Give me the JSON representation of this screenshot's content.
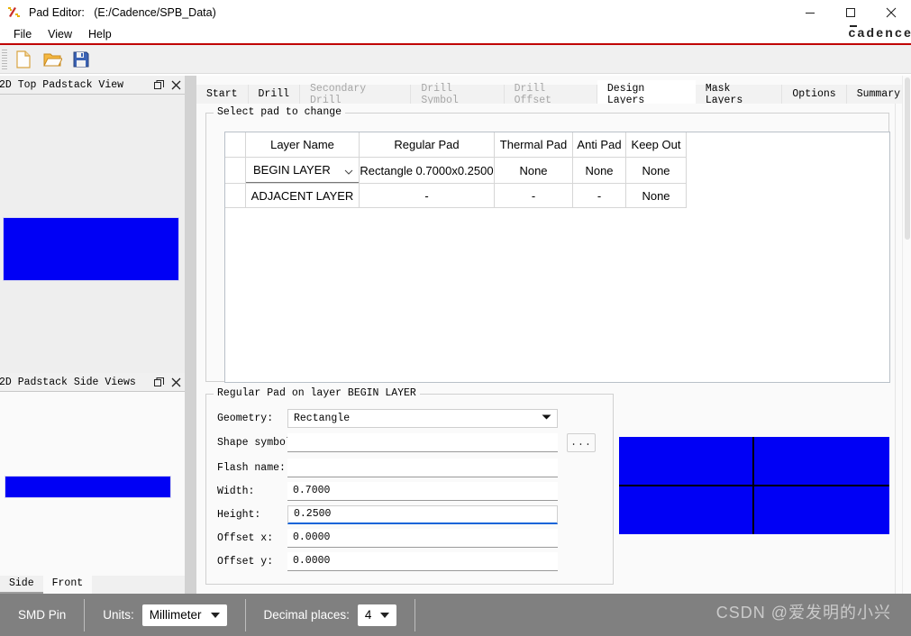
{
  "window": {
    "title": "Pad Editor:   (E:/Cadence/SPB_Data)",
    "icon": "pad-editor-icon",
    "minimize": "minimize-icon",
    "maximize": "maximize-icon",
    "close": "close-icon",
    "brand": "cadence"
  },
  "menubar": {
    "items": [
      {
        "label": "File"
      },
      {
        "label": "View"
      },
      {
        "label": "Help"
      }
    ]
  },
  "toolbar": {
    "buttons": [
      {
        "name": "new-icon",
        "tooltip": "New"
      },
      {
        "name": "open-icon",
        "tooltip": "Open"
      },
      {
        "name": "save-icon",
        "tooltip": "Save"
      }
    ]
  },
  "left_panels": [
    {
      "title": "2D Top Padstack View",
      "float_icon": "restore-icon",
      "close_icon": "close-icon"
    },
    {
      "title": "2D Padstack Side Views",
      "float_icon": "restore-icon",
      "close_icon": "close-icon"
    }
  ],
  "side_tabs": [
    {
      "label": "Side",
      "active": true
    },
    {
      "label": "Front",
      "active": false
    }
  ],
  "tabs": [
    {
      "label": "Start",
      "state": "normal"
    },
    {
      "label": "Drill",
      "state": "normal"
    },
    {
      "label": "Secondary Drill",
      "state": "disabled"
    },
    {
      "label": "Drill Symbol",
      "state": "disabled"
    },
    {
      "label": "Drill Offset",
      "state": "disabled"
    },
    {
      "label": "Design Layers",
      "state": "active"
    },
    {
      "label": "Mask Layers",
      "state": "normal"
    },
    {
      "label": "Options",
      "state": "normal"
    },
    {
      "label": "Summary",
      "state": "normal"
    }
  ],
  "select_pad_group": {
    "title": "Select pad to change"
  },
  "pad_table": {
    "headers": [
      "",
      "Layer Name",
      "Regular Pad",
      "Thermal Pad",
      "Anti Pad",
      "Keep Out"
    ],
    "rows": [
      {
        "layer": "BEGIN LAYER",
        "layer_is_select": true,
        "regular": "Rectangle 0.7000x0.2500",
        "thermal": "None",
        "anti": "None",
        "keepout": "None",
        "dim": false
      },
      {
        "layer": "ADJACENT LAYER",
        "layer_is_select": false,
        "regular": "-",
        "thermal": "-",
        "anti": "-",
        "keepout": "None",
        "dim": true
      }
    ]
  },
  "regular_pad_group": {
    "title": "Regular Pad on layer BEGIN LAYER",
    "fields": [
      {
        "label": "Geometry:",
        "value": "Rectangle",
        "type": "select"
      },
      {
        "label": "Shape symbol:",
        "value": "",
        "type": "text-with-button",
        "button": "..."
      },
      {
        "label": "Flash name:",
        "value": "",
        "type": "text"
      },
      {
        "label": "Width:",
        "value": "0.7000",
        "type": "text"
      },
      {
        "label": "Height:",
        "value": "0.2500",
        "type": "text",
        "focused": true
      },
      {
        "label": "Offset x:",
        "value": "0.0000",
        "type": "text"
      },
      {
        "label": "Offset y:",
        "value": "0.0000",
        "type": "text"
      }
    ]
  },
  "preview": {
    "pad_color": "#0000f5",
    "crosshair_color": "#000000"
  },
  "statusbar": {
    "pin_type": "SMD Pin",
    "units_label": "Units:",
    "units_value": "Millimeter",
    "decimals_label": "Decimal places:",
    "decimals_value": "4"
  },
  "watermark": "CSDN @爱发明的小兴"
}
